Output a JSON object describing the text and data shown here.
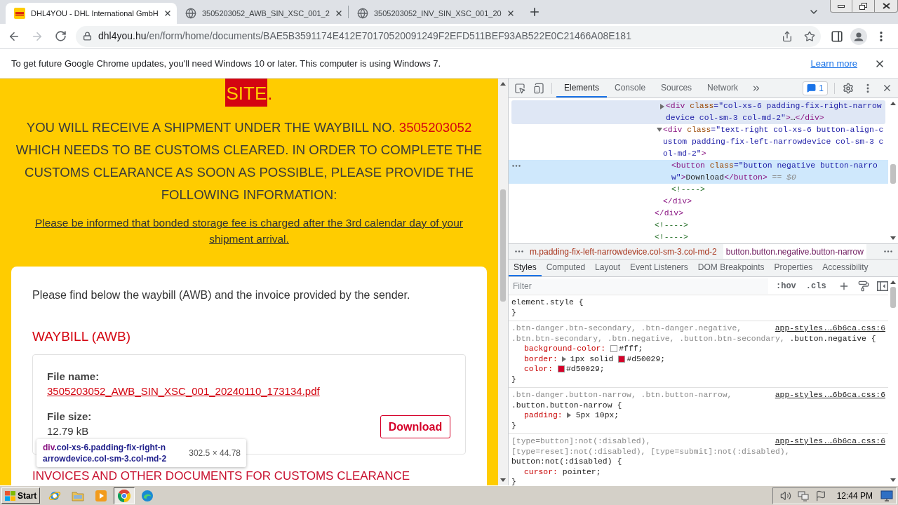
{
  "browser": {
    "tabs": [
      {
        "title": "DHL4YOU - DHL International GmbH",
        "kind": "logo",
        "selected": true
      },
      {
        "title": "3505203052_AWB_SIN_XSC_001_2",
        "kind": "globe",
        "selected": false
      },
      {
        "title": "3505203052_INV_SIN_XSC_001_20",
        "kind": "globe",
        "selected": false
      }
    ],
    "nav": [
      {
        "kind": "back",
        "disabled": false
      },
      {
        "kind": "forward",
        "disabled": true
      },
      {
        "kind": "reload",
        "disabled": false
      }
    ],
    "url": {
      "host": "dhl4you.hu",
      "path": "/en/form/home/documents/BAE5B3591174E412E70170520091249F2EFD511BEF93AB522E0C21466A08E181"
    },
    "infobar": {
      "message": "To get future Google Chrome updates, you'll need Windows 10 or later. This computer is using Windows 7.",
      "link": "Learn more"
    }
  },
  "page": {
    "top_line": {
      "highlight": "SITE",
      "after": "."
    },
    "intro": {
      "before": "YOU WILL RECEIVE A SHIPMENT UNDER THE WAYBILL NO. ",
      "waybill_no": "3505203052",
      "after": " WHICH NEEDS TO BE CUSTOMS CLEARED. IN ORDER TO COMPLETE THE CUSTOMS CLEARANCE AS SOON AS POSSIBLE, PLEASE PROVIDE THE FOLLOWING INFORMATION:"
    },
    "notice": "Please be informed that bonded storage fee is charged after the 3rd calendar day of your shipment arrival.",
    "card": {
      "lead": "Please find below the waybill (AWB) and the invoice provided by the sender.",
      "waybill_heading": "WAYBILL (AWB)",
      "file": {
        "name_label": "File name:",
        "name": "3505203052_AWB_SIN_XSC_001_20240110_173134.pdf",
        "size_label": "File size:",
        "size": "12.79 kB",
        "button": "Download"
      },
      "next_heading": "INVOICES AND OTHER DOCUMENTS FOR CUSTOMS CLEARANCE"
    },
    "inspect_tooltip": {
      "tag": "div",
      "classes": ".col-xs-6.padding-fix-right-narrowdevice.col-sm-3.col-md-2",
      "size": "302.5 × 44.78"
    }
  },
  "devtools": {
    "tabs": [
      {
        "label": "Elements",
        "selected": true
      },
      {
        "label": "Console",
        "selected": false
      },
      {
        "label": "Sources",
        "selected": false
      },
      {
        "label": "Network",
        "selected": false
      }
    ],
    "issues": "1",
    "dom_tree": [
      {
        "kind": "element",
        "children": [
          {
            "kind": "element",
            "expanded": false,
            "hovered": true,
            "selected": false,
            "open": [
              {
                "kind": "tag",
                "text": "<div"
              },
              {
                "kind": "attr",
                "text": " class"
              },
              {
                "kind": "value",
                "text": "=\"col-xs-6 padding-fix-right-narrowdevice col-sm-3 col-md-2\""
              },
              {
                "kind": "tag",
                "text": ">"
              },
              {
                "kind": "content",
                "text": "…"
              },
              {
                "kind": "tag",
                "text": "</div>"
              }
            ]
          },
          {
            "kind": "element",
            "expanded": true,
            "hovered": false,
            "selected": false,
            "open": [
              {
                "kind": "tag",
                "text": "<div"
              },
              {
                "kind": "attr",
                "text": " class"
              },
              {
                "kind": "value",
                "text": "=\"text-right col-xs-6 button-align-custom padding-fix-left-narrowdevice col-sm-3 col-md-2\""
              },
              {
                "kind": "tag",
                "text": ">"
              }
            ],
            "children": [
              {
                "kind": "element",
                "hovered": false,
                "selected": true,
                "open": [
                  {
                    "kind": "tag",
                    "text": "<button"
                  },
                  {
                    "kind": "attr",
                    "text": " class"
                  },
                  {
                    "kind": "value",
                    "text": "=\"button negative button-narrow\""
                  },
                  {
                    "kind": "tag",
                    "text": ">"
                  },
                  {
                    "kind": "content",
                    "text": "Download"
                  },
                  {
                    "kind": "tag",
                    "text": "</button>"
                  },
                  {
                    "kind": "meta",
                    "text": " == $0"
                  }
                ]
              },
              {
                "kind": "comment",
                "hovered": false,
                "selected": false,
                "text": "<!---->"
              }
            ],
            "close": [
              {
                "kind": "tag",
                "text": "</div>"
              }
            ]
          }
        ],
        "close": [
          {
            "kind": "tag",
            "text": "</div>"
          }
        ]
      },
      {
        "kind": "comment",
        "hovered": false,
        "selected": false,
        "text": "<!---->"
      },
      {
        "kind": "comment",
        "hovered": false,
        "selected": false,
        "text": "<!---->"
      }
    ],
    "breadcrumbs": [
      {
        "label": "m.padding-fix-left-narrowdevice.col-sm-3.col-md-2",
        "selected": false
      },
      {
        "label": "button.button.negative.button-narrow",
        "selected": true
      }
    ],
    "pane_tabs": [
      {
        "label": "Styles",
        "selected": true
      },
      {
        "label": "Computed",
        "selected": false
      },
      {
        "label": "Layout",
        "selected": false
      },
      {
        "label": "Event Listeners",
        "selected": false
      },
      {
        "label": "DOM Breakpoints",
        "selected": false
      },
      {
        "label": "Properties",
        "selected": false
      },
      {
        "label": "Accessibility",
        "selected": false
      }
    ],
    "filter": {
      "placeholder": "Filter"
    },
    "toggles": [
      ":hov",
      ".cls"
    ],
    "rules": [
      {
        "selectors": [
          {
            "s": "element.style",
            "matched": true
          }
        ],
        "brace_open": "{",
        "brace_close": "}"
      },
      {
        "source": "app-styles.…6b6ca.css:6",
        "selectors": [
          {
            "s": ".btn-danger.btn-secondary,",
            "matched": false
          },
          {
            "s": ".btn-danger.negative,",
            "matched": false
          },
          {
            "s": ".btn.btn-secondary,",
            "matched": false
          },
          {
            "s": ".btn.negative,",
            "matched": false
          },
          {
            "s": ".button.btn-secondary,",
            "matched": false
          },
          {
            "s": ".button.negative",
            "matched": true
          }
        ],
        "brace_open": "{",
        "declarations": [
          {
            "prop": "background-color:",
            "color": "#ffffff",
            "value": "#fff;"
          },
          {
            "prop": "border:",
            "expandable": true,
            "value_before": "1px solid",
            "color": "#d50029",
            "value": "#d50029;"
          },
          {
            "prop": "color:",
            "color": "#d50029",
            "value": "#d50029;"
          }
        ],
        "brace_close": "}"
      },
      {
        "source": "app-styles.…6b6ca.css:6",
        "selectors": [
          {
            "s": ".btn-danger.button-narrow,",
            "matched": false
          },
          {
            "s": ".btn.button-narrow,",
            "matched": false
          },
          {
            "s": ".button.button-narrow",
            "matched": true
          }
        ],
        "brace_open": "{",
        "declarations": [
          {
            "prop": "padding:",
            "expandable": true,
            "value": "5px 10px;"
          }
        ],
        "brace_close": "}"
      },
      {
        "source": "app-styles.…6b6ca.css:6",
        "selectors": [
          {
            "s": "[type=button]:not(:disabled),",
            "matched": false
          },
          {
            "s": "[type=reset]:not(:disabled),",
            "matched": false
          },
          {
            "s": "[type=submit]:not(:disabled),",
            "matched": false
          },
          {
            "s": "button:not(:disabled)",
            "matched": true
          }
        ],
        "brace_open": "{",
        "declarations": [
          {
            "prop": "cursor:",
            "value": "pointer;"
          }
        ],
        "brace_close": "}"
      }
    ]
  },
  "taskbar": {
    "start": "Start",
    "apps": [
      {
        "kind": "ie",
        "selected": false
      },
      {
        "kind": "folder",
        "selected": false
      },
      {
        "kind": "media",
        "selected": false
      },
      {
        "kind": "chrome",
        "selected": true
      },
      {
        "kind": "edge",
        "selected": false
      }
    ],
    "time": "12:44 PM"
  }
}
